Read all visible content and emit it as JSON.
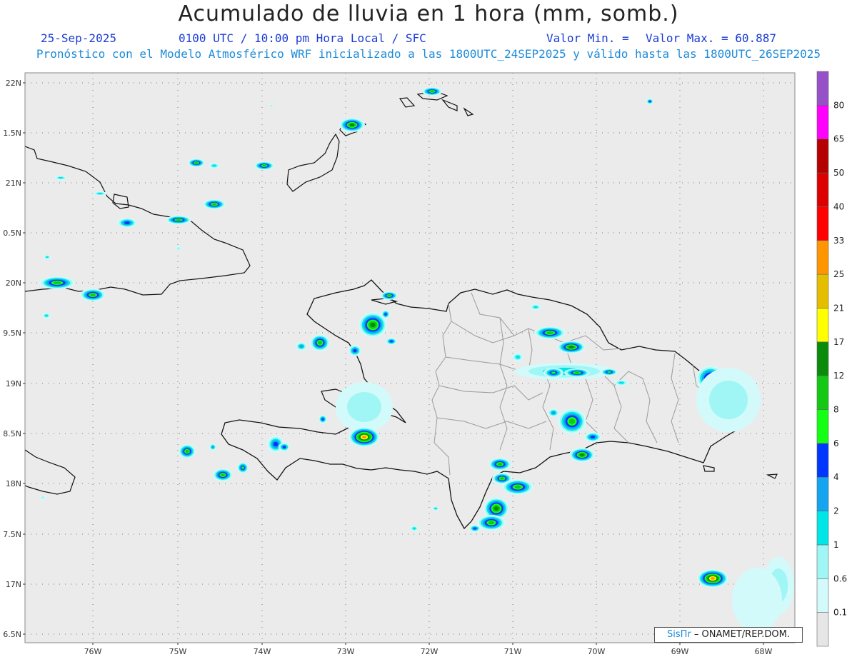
{
  "header": {
    "title": "Acumulado de lluvia en 1 hora (mm, somb.)",
    "date": "25-Sep-2025",
    "time": "0100 UTC / 10:00 pm Hora Local / SFC",
    "valor_min_label": "Valor Min. =",
    "valor_max_label": "Valor Max. = 60.887",
    "model_info": "Pronóstico con el Modelo Atmosférico WRF inicializado a las 1800UTC_24SEP2025 y válido hasta las  1800UTC_26SEP2025"
  },
  "map": {
    "lat_labels": [
      "22N",
      "1.5N",
      "21N",
      "0.5N",
      "20N",
      "9.5N",
      "19N",
      "8.5N",
      "18N",
      "7.5N",
      "17N",
      "6.5N"
    ],
    "lon_labels": [
      "76W",
      "75W",
      "74W",
      "73W",
      "72W",
      "71W",
      "70W",
      "69W",
      "68W"
    ],
    "colors": {
      "land_border": "#111111",
      "province_border": "#9a9a9a",
      "background": "#ebebeb",
      "grid": "#7a7a7a"
    }
  },
  "colorbar": {
    "labels": [
      "0.1",
      "0.6",
      "1",
      "2",
      "4",
      "6",
      "8",
      "12",
      "17",
      "21",
      "25",
      "33",
      "40",
      "50",
      "65",
      "80"
    ],
    "colors": [
      "#e6e6e6",
      "#d2fafa",
      "#a0f5f5",
      "#00e6e6",
      "#14a5f0",
      "#0037ff",
      "#14ff14",
      "#14c814",
      "#0a8c0a",
      "#ffff00",
      "#e6be00",
      "#ff9600",
      "#ff0000",
      "#dc0000",
      "#b40000",
      "#ff00ff",
      "#9650c8"
    ]
  },
  "credit": {
    "brand": "SisПr",
    "text": " – ONAMET/REP.DOM."
  }
}
